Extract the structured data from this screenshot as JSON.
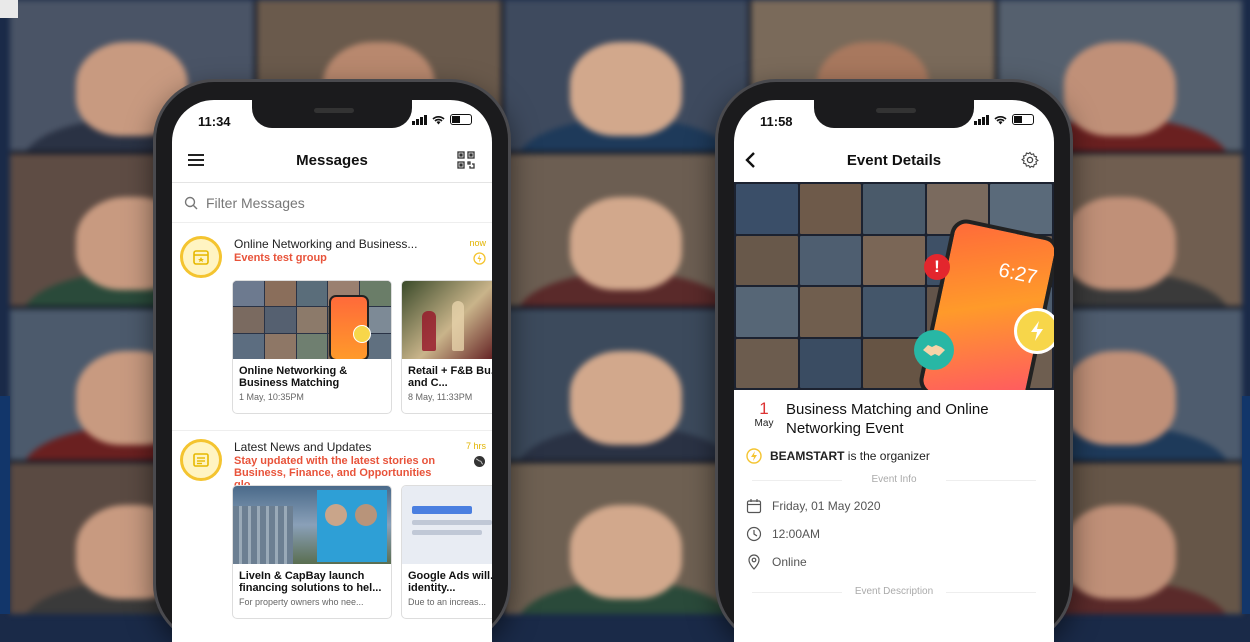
{
  "colors": {
    "accent_orange": "#e8533a",
    "accent_yellow": "#f4c430",
    "time_yellow": "#e2b400",
    "date_red": "#d33333"
  },
  "left_phone": {
    "status_time": "11:34",
    "nav_title": "Messages",
    "menu_icon": "hamburger-icon",
    "qr_icon": "qr-code-icon",
    "search_placeholder": "Filter Messages",
    "threads": [
      {
        "title": "Online Networking and Business...",
        "subtitle": "Events test group",
        "time": "now",
        "cards": [
          {
            "title": "Online Networking & Business Matching",
            "meta": "1 May, 10:35PM"
          },
          {
            "title": "Retail + F&B Bu... Matching and C...",
            "meta": "8 May, 11:33PM"
          }
        ]
      },
      {
        "title": "Latest News and Updates",
        "subtitle": "Stay updated with the latest stories on Business, Finance, and Opportunities glo...",
        "time": "7 hrs",
        "cards": [
          {
            "title": "LiveIn & CapBay launch financing solutions to hel...",
            "meta": "For property owners who nee..."
          },
          {
            "title": "Google Ads will... require identity...",
            "meta": "Due to an increas..."
          }
        ]
      }
    ]
  },
  "right_phone": {
    "status_time": "11:58",
    "nav_title": "Event Details",
    "back_icon": "chevron-left-icon",
    "settings_icon": "gear-icon",
    "date_day": "1",
    "date_month": "May",
    "event_title": "Business Matching and Online Networking Event",
    "organizer_name": "BEAMSTART",
    "organizer_suffix": "is the organizer",
    "event_info_label": "Event Info",
    "date_text": "Friday, 01 May 2020",
    "time_text": "12:00AM",
    "location_text": "Online",
    "event_description_label": "Event Description",
    "hero_clock": "6:27"
  }
}
